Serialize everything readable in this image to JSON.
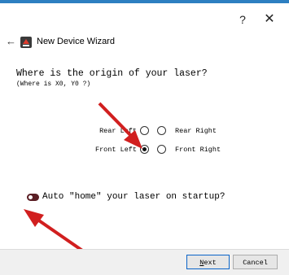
{
  "window": {
    "help_label": "?",
    "close_label": "✕"
  },
  "header": {
    "back_label": "←",
    "title": "New Device Wizard"
  },
  "question": {
    "main": "Where is the origin of your laser?",
    "sub": "(Where is X0, Y0 ?)"
  },
  "origin_options": {
    "rear_left": "Rear Left",
    "rear_right": "Rear Right",
    "front_left": "Front Left",
    "front_right": "Front Right",
    "selected": "front_left"
  },
  "auto_home": {
    "label": "Auto \"home\" your laser on startup?",
    "enabled": true
  },
  "buttons": {
    "next_accel": "N",
    "next_rest": "ext",
    "cancel": "Cancel"
  },
  "colors": {
    "titlebar_accent": "#2d7fc1",
    "toggle_on": "#5a1e24",
    "annotation_arrow": "#d11f1f"
  }
}
